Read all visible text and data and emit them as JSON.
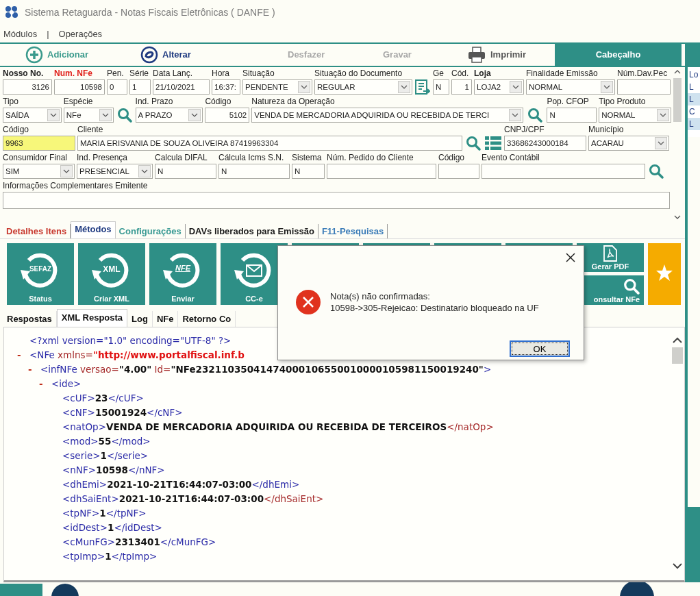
{
  "window": {
    "title": "Sistema Retaguarda - Notas Fiscais Eletrônicas ( DANFE )"
  },
  "menu": {
    "items": [
      "Módulos",
      "Operações"
    ],
    "separator": "|"
  },
  "toolbar": {
    "buttons": [
      {
        "label": "Adicionar",
        "kind": "add",
        "disabled": false
      },
      {
        "label": "Alterar",
        "kind": "edit",
        "disabled": false
      },
      {
        "label": "Desfazer",
        "kind": "undo",
        "disabled": true
      },
      {
        "label": "Gravar",
        "kind": "save",
        "disabled": true
      },
      {
        "label": "Imprimir",
        "kind": "print",
        "disabled": false
      }
    ],
    "header_tab": "Cabeçalho"
  },
  "form": {
    "lines": [
      [
        {
          "label": "Nosso No.",
          "label_bold": true,
          "kind": "text",
          "value": "3126",
          "highlighted": false
        },
        {
          "label": "Num. NFe",
          "required": true,
          "kind": "text",
          "value": "10598",
          "highlighted": false
        },
        {
          "label": "Pen.",
          "kind": "text",
          "value": "0",
          "highlighted": false
        },
        {
          "label": "Série",
          "kind": "text",
          "value": "1",
          "highlighted": false
        },
        {
          "label": "Data Lanç.",
          "kind": "text",
          "value": "21/10/2021",
          "highlighted": false
        },
        {
          "label": "Hora",
          "kind": "text",
          "value": "16:37:",
          "highlighted": false
        },
        {
          "label": "Situação",
          "kind": "select",
          "value": "PENDENTE"
        },
        {
          "label": "Situação do Documento",
          "kind": "select",
          "value": "REGULAR"
        },
        {
          "kind": "document"
        },
        {
          "label": "Ge",
          "kind": "text",
          "value": "N",
          "highlighted": false
        },
        {
          "label": "Cód.",
          "kind": "text",
          "value": "1",
          "highlighted": false
        },
        {
          "label": "Loja",
          "label_bold": true,
          "kind": "select",
          "value": "LOJA2"
        },
        {
          "label": "Finalidade Emissão",
          "kind": "select",
          "value": "NORMAL"
        },
        {
          "label": "Núm.Dav.Pec",
          "kind": "text",
          "highlighted": false
        }
      ],
      [
        {
          "label": "Tipo",
          "kind": "select",
          "value": "SAÍDA"
        },
        {
          "label": "Espécie",
          "kind": "select",
          "value": "NFe"
        },
        {
          "kind": "search"
        },
        {
          "label": "Ind. Prazo",
          "kind": "select",
          "value": "A PRAZO"
        },
        {
          "label": "Código",
          "kind": "text",
          "value": "5102",
          "highlighted": false
        },
        {
          "label": "Natureza da Operação",
          "kind": "select",
          "value": "VENDA DE MERCADORIA ADQUIRIDA OU RECEBIDA DE TERCI"
        },
        {
          "kind": "search"
        },
        {
          "label": "Pop. CFOP",
          "kind": "text",
          "value": "N",
          "highlighted": false
        },
        {
          "label": "Tipo Produto",
          "kind": "select",
          "value": "NORMAL"
        }
      ],
      [
        {
          "label": "Código",
          "kind": "text",
          "value": "9963",
          "highlighted": true
        },
        {
          "label": "Cliente",
          "kind": "text",
          "value": "MARIA ERISVANIA DE SOUZA OLIVEIRA 87419963304",
          "highlighted": false
        },
        {
          "kind": "search"
        },
        {
          "kind": "list"
        },
        {
          "label": "CNPJ/CPF",
          "kind": "text",
          "value": "33686243000184",
          "highlighted": false
        },
        {
          "label": "Município",
          "kind": "select",
          "value": "ACARAU"
        }
      ],
      [
        {
          "label": "Consumidor Final",
          "kind": "select",
          "value": "SIM"
        },
        {
          "label": "Ind. Presença",
          "kind": "select",
          "value": "PRESENCIAL"
        },
        {
          "label": "Calcula DIFAL",
          "kind": "text",
          "value": "N",
          "highlighted": false
        },
        {
          "label": "Cálcula Icms S.N.",
          "kind": "text",
          "value": "N",
          "highlighted": false
        },
        {
          "label": "Sistema",
          "kind": "text",
          "value": "N",
          "highlighted": false
        },
        {
          "label": "Núm. Pedido do Cliente",
          "kind": "text",
          "highlighted": false
        },
        {
          "label": "Código",
          "kind": "text",
          "highlighted": false
        },
        {
          "label": "Evento Contábil",
          "kind": "text",
          "highlighted": false
        },
        {
          "kind": "search"
        }
      ],
      [
        {
          "label": "Informações Complementares Emitente",
          "kind": "text",
          "highlighted": false
        }
      ]
    ]
  },
  "side_list": [
    {
      "label": "Lo",
      "selected": false
    },
    {
      "label": "L",
      "selected": false
    },
    {
      "label": "L",
      "selected": true
    },
    {
      "label": "C",
      "selected": false
    },
    {
      "label": "L",
      "selected": true
    }
  ],
  "section_tabs": [
    {
      "label": "Detalhes Itens",
      "color": "#c8382e",
      "selected": false
    },
    {
      "label": "Métodos",
      "color": "#1f3a80",
      "selected": true
    },
    {
      "label": "Configurações",
      "color": "#3a9a94",
      "selected": false
    },
    {
      "label": "DAVs liberados para Emissão",
      "color": "#1a1a1a",
      "selected": false
    },
    {
      "label": "F11-Pesquisas",
      "color": "#3b7cb8",
      "selected": false
    }
  ],
  "method_tiles": [
    {
      "kind": "status",
      "label": "Status",
      "icon_text": "SEFAZ"
    },
    {
      "kind": "xml",
      "label": "Criar XML",
      "icon_text": "XML"
    },
    {
      "kind": "send",
      "label": "Enviar",
      "icon_text": "NFE"
    },
    {
      "kind": "mail",
      "label": "CC-e"
    },
    {
      "kind": "blank"
    },
    {
      "kind": "blank"
    },
    {
      "kind": "blank"
    },
    {
      "kind": "blank"
    },
    {
      "kind": "pdf",
      "label": "Gerar PDF"
    },
    {
      "kind": "search",
      "label": "onsultar NFe"
    },
    {
      "kind": "star"
    }
  ],
  "response_tabs": [
    {
      "label": "Respostas",
      "selected": false
    },
    {
      "label": "XML Resposta",
      "selected": true
    },
    {
      "label": "Log",
      "selected": false
    },
    {
      "label": "NFe",
      "selected": false
    },
    {
      "label": "Retorno Co",
      "selected": false
    }
  ],
  "xml": {
    "declaration": "<?xml version=\"1.0\" encoding=\"UTF-8\" ?>",
    "nodes": [
      {
        "toggle": "-",
        "parts": [
          {
            "kind": "tag",
            "text": "<NFe"
          },
          {
            "kind": "attr",
            "text": "xmlns="
          },
          {
            "kind": "url",
            "text": "\"http://www.portalfiscal.inf.b"
          }
        ],
        "children": [
          {
            "toggle": "-",
            "parts": [
              {
                "kind": "tag",
                "text": "<infNFe"
              },
              {
                "kind": "attr",
                "text": "versao="
              },
              {
                "kind": "value",
                "text": "\"4.00\""
              },
              {
                "kind": "attr",
                "text": "Id="
              },
              {
                "kind": "value",
                "text": "\"NFe23211035041474000106550010000105981150019240\""
              },
              {
                "kind": "tag",
                "text": ">"
              }
            ],
            "children": [
              {
                "toggle": "-",
                "parts": [
                  {
                    "kind": "tag",
                    "text": "<ide>"
                  }
                ],
                "children": [
                  {
                    "parts": [
                      {
                        "kind": "tag",
                        "text": "<cUF>"
                      },
                      {
                        "kind": "value",
                        "text": "23"
                      },
                      {
                        "kind": "tag",
                        "text": "</cUF>"
                      }
                    ]
                  },
                  {
                    "parts": [
                      {
                        "kind": "tag",
                        "text": "<cNF>"
                      },
                      {
                        "kind": "value",
                        "text": "15001924"
                      },
                      {
                        "kind": "tag",
                        "text": "</cNF>"
                      }
                    ]
                  },
                  {
                    "parts": [
                      {
                        "kind": "tag",
                        "text": "<natOp>"
                      },
                      {
                        "kind": "value",
                        "text": "VENDA DE MERCADORIA ADQUIRIDA OU RECEBIDA DE TERCEIROS"
                      },
                      {
                        "kind": "close",
                        "text": "</natOp>"
                      }
                    ]
                  },
                  {
                    "parts": [
                      {
                        "kind": "tag",
                        "text": "<mod>"
                      },
                      {
                        "kind": "value",
                        "text": "55"
                      },
                      {
                        "kind": "tag",
                        "text": "</mod>"
                      }
                    ]
                  },
                  {
                    "parts": [
                      {
                        "kind": "tag",
                        "text": "<serie>"
                      },
                      {
                        "kind": "value",
                        "text": "1"
                      },
                      {
                        "kind": "tag",
                        "text": "</serie>"
                      }
                    ]
                  },
                  {
                    "parts": [
                      {
                        "kind": "tag",
                        "text": "<nNF>"
                      },
                      {
                        "kind": "value",
                        "text": "10598"
                      },
                      {
                        "kind": "tag",
                        "text": "</nNF>"
                      }
                    ]
                  },
                  {
                    "parts": [
                      {
                        "kind": "tag",
                        "text": "<dhEmi>"
                      },
                      {
                        "kind": "value",
                        "text": "2021-10-21T16:44:07-03:00"
                      },
                      {
                        "kind": "tag",
                        "text": "</dhEmi>"
                      }
                    ]
                  },
                  {
                    "parts": [
                      {
                        "kind": "tag",
                        "text": "<dhSaiEnt>"
                      },
                      {
                        "kind": "value",
                        "text": "2021-10-21T16:44:07-03:00"
                      },
                      {
                        "kind": "close",
                        "text": "</dhSaiEnt>"
                      }
                    ]
                  },
                  {
                    "parts": [
                      {
                        "kind": "tag",
                        "text": "<tpNF>"
                      },
                      {
                        "kind": "value",
                        "text": "1"
                      },
                      {
                        "kind": "tag",
                        "text": "</tpNF>"
                      }
                    ]
                  },
                  {
                    "parts": [
                      {
                        "kind": "tag",
                        "text": "<idDest>"
                      },
                      {
                        "kind": "value",
                        "text": "1"
                      },
                      {
                        "kind": "tag",
                        "text": "</idDest>"
                      }
                    ]
                  },
                  {
                    "parts": [
                      {
                        "kind": "tag",
                        "text": "<cMunFG>"
                      },
                      {
                        "kind": "value",
                        "text": "2313401"
                      },
                      {
                        "kind": "tag",
                        "text": "</cMunFG>"
                      }
                    ]
                  },
                  {
                    "parts": [
                      {
                        "kind": "tag",
                        "text": "<tpImp>"
                      },
                      {
                        "kind": "value",
                        "text": "1"
                      },
                      {
                        "kind": "tag",
                        "text": "</tpImp>"
                      }
                    ]
                  }
                ]
              }
            ]
          }
        ]
      }
    ]
  },
  "dialog": {
    "lines": [
      "Nota(s) não confirmadas:",
      "10598->305-Rejeicao: Destinatario bloqueado na UF"
    ],
    "button": "OK"
  }
}
